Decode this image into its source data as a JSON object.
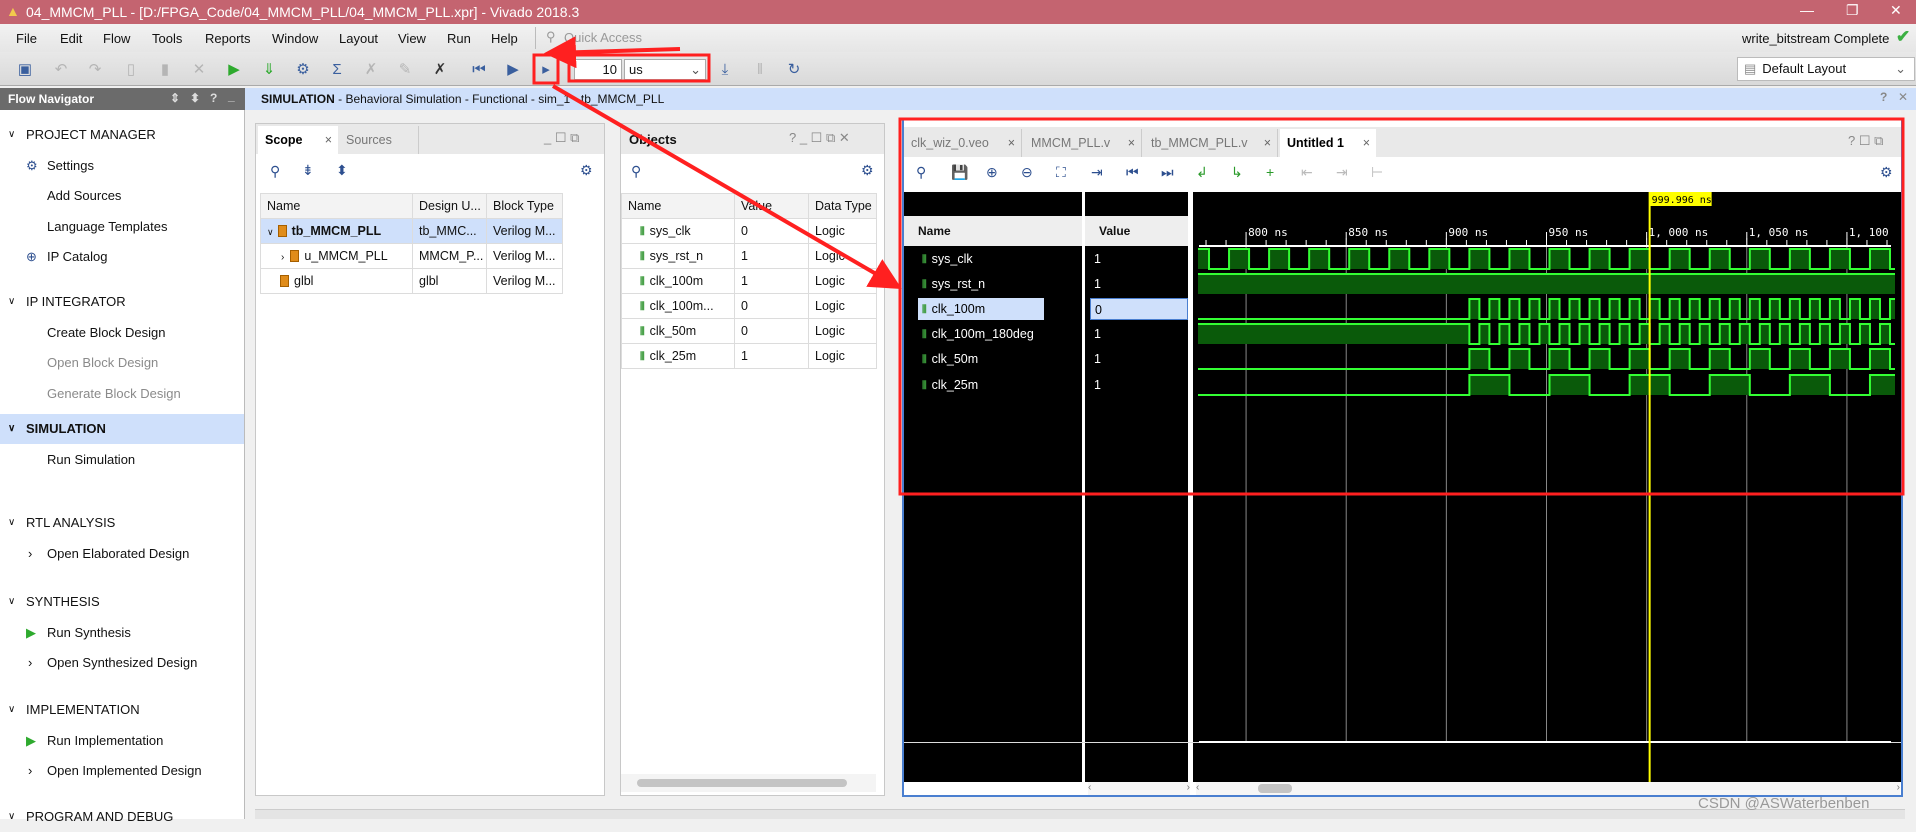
{
  "window": {
    "title": "04_MMCM_PLL - [D:/FPGA_Code/04_MMCM_PLL/04_MMCM_PLL.xpr] - Vivado 2018.3",
    "controls": [
      "minimize-icon",
      "restore-icon",
      "close-icon"
    ]
  },
  "menu": [
    "File",
    "Edit",
    "Flow",
    "Tools",
    "Reports",
    "Window",
    "Layout",
    "View",
    "Run",
    "Help"
  ],
  "quick_access": {
    "placeholder": "Quick Access"
  },
  "status": {
    "text": "write_bitstream Complete",
    "color": "#3cb043"
  },
  "toolbar": {
    "run_time_value": "10",
    "run_time_unit": "us",
    "layout": "Default Layout"
  },
  "flow_navigator": {
    "title": "Flow Navigator",
    "sections": [
      {
        "label": "PROJECT MANAGER",
        "items": [
          {
            "label": "Settings",
            "icon": "gear-icon"
          },
          {
            "label": "Add Sources"
          },
          {
            "label": "Language Templates"
          },
          {
            "label": "IP Catalog",
            "icon": "ip-icon"
          }
        ]
      },
      {
        "label": "IP INTEGRATOR",
        "items": [
          {
            "label": "Create Block Design"
          },
          {
            "label": "Open Block Design",
            "disabled": true
          },
          {
            "label": "Generate Block Design",
            "disabled": true
          }
        ]
      },
      {
        "label": "SIMULATION",
        "active": true,
        "items": [
          {
            "label": "Run Simulation"
          }
        ]
      },
      {
        "label": "RTL ANALYSIS",
        "items": [
          {
            "label": "Open Elaborated Design",
            "expand": true
          }
        ]
      },
      {
        "label": "SYNTHESIS",
        "items": [
          {
            "label": "Run Synthesis",
            "icon": "play-icon"
          },
          {
            "label": "Open Synthesized Design",
            "expand": true
          }
        ]
      },
      {
        "label": "IMPLEMENTATION",
        "items": [
          {
            "label": "Run Implementation",
            "icon": "play-icon"
          },
          {
            "label": "Open Implemented Design",
            "expand": true
          }
        ]
      },
      {
        "label": "PROGRAM AND DEBUG",
        "items": []
      }
    ]
  },
  "sim_header": {
    "bold": "SIMULATION",
    "rest": " - Behavioral Simulation - Functional - sim_1 - tb_MMCM_PLL"
  },
  "scope": {
    "tabs": [
      "Scope",
      "Sources"
    ],
    "columns": [
      "Name",
      "Design U...",
      "Block Type"
    ],
    "rows": [
      {
        "name": "tb_MMCM_PLL",
        "design": "tb_MMC...",
        "type": "Verilog M...",
        "selected": true
      },
      {
        "name": "u_MMCM_PLL",
        "design": "MMCM_P...",
        "type": "Verilog M..."
      },
      {
        "name": "glbl",
        "design": "glbl",
        "type": "Verilog M..."
      }
    ]
  },
  "objects": {
    "title": "Objects",
    "columns": [
      "Name",
      "Value",
      "Data Type"
    ],
    "rows": [
      {
        "name": "sys_clk",
        "value": "0",
        "type": "Logic"
      },
      {
        "name": "sys_rst_n",
        "value": "1",
        "type": "Logic"
      },
      {
        "name": "clk_100m",
        "value": "1",
        "type": "Logic"
      },
      {
        "name": "clk_100m...",
        "value": "0",
        "type": "Logic"
      },
      {
        "name": "clk_50m",
        "value": "0",
        "type": "Logic"
      },
      {
        "name": "clk_25m",
        "value": "1",
        "type": "Logic"
      }
    ]
  },
  "wave": {
    "tabs": [
      "clk_wiz_0.veo",
      "MMCM_PLL.v",
      "tb_MMCM_PLL.v",
      "Untitled 1"
    ],
    "name_header": "Name",
    "value_header": "Value",
    "cursor": {
      "label": "999.996 ns",
      "time_ns": 999.996,
      "color": "#ffff00"
    },
    "time_axis": {
      "range_ns": [
        774.5,
        1124
      ],
      "ticks": [
        {
          "t": 800,
          "label": "800 ns"
        },
        {
          "t": 850,
          "label": "850 ns"
        },
        {
          "t": 900,
          "label": "900 ns"
        },
        {
          "t": 950,
          "label": "950 ns"
        },
        {
          "t": 1000,
          "label": "1, 000 ns"
        },
        {
          "t": 1050,
          "label": "1, 050 ns"
        },
        {
          "t": 1100,
          "label": "1, 100 ns"
        }
      ]
    },
    "wave_color": "#33ff33",
    "signals": [
      {
        "name": "sys_clk",
        "value": "1",
        "initial": 0,
        "clock": {
          "first_rise_ns": 770,
          "period_ns": 20,
          "high_ns": 10
        }
      },
      {
        "name": "sys_rst_n",
        "value": "1",
        "initial": 1,
        "clock": null
      },
      {
        "name": "clk_100m",
        "value": "0",
        "initial": 0,
        "clock": {
          "first_rise_ns": 910,
          "period_ns": 10,
          "high_ns": 5
        },
        "selected": true
      },
      {
        "name": "clk_100m_180deg",
        "value": "1",
        "initial": 1,
        "clock": {
          "first_rise_ns": 915,
          "period_ns": 10,
          "high_ns": 5,
          "low_from_ns": 910
        }
      },
      {
        "name": "clk_50m",
        "value": "1",
        "initial": 0,
        "clock": {
          "first_rise_ns": 910,
          "period_ns": 20,
          "high_ns": 10
        }
      },
      {
        "name": "clk_25m",
        "value": "1",
        "initial": 0,
        "clock": {
          "first_rise_ns": 910,
          "period_ns": 40,
          "high_ns": 20
        }
      }
    ]
  },
  "watermark": "CSDN @ASWaterbenben",
  "annotation_color": "#ff2020"
}
